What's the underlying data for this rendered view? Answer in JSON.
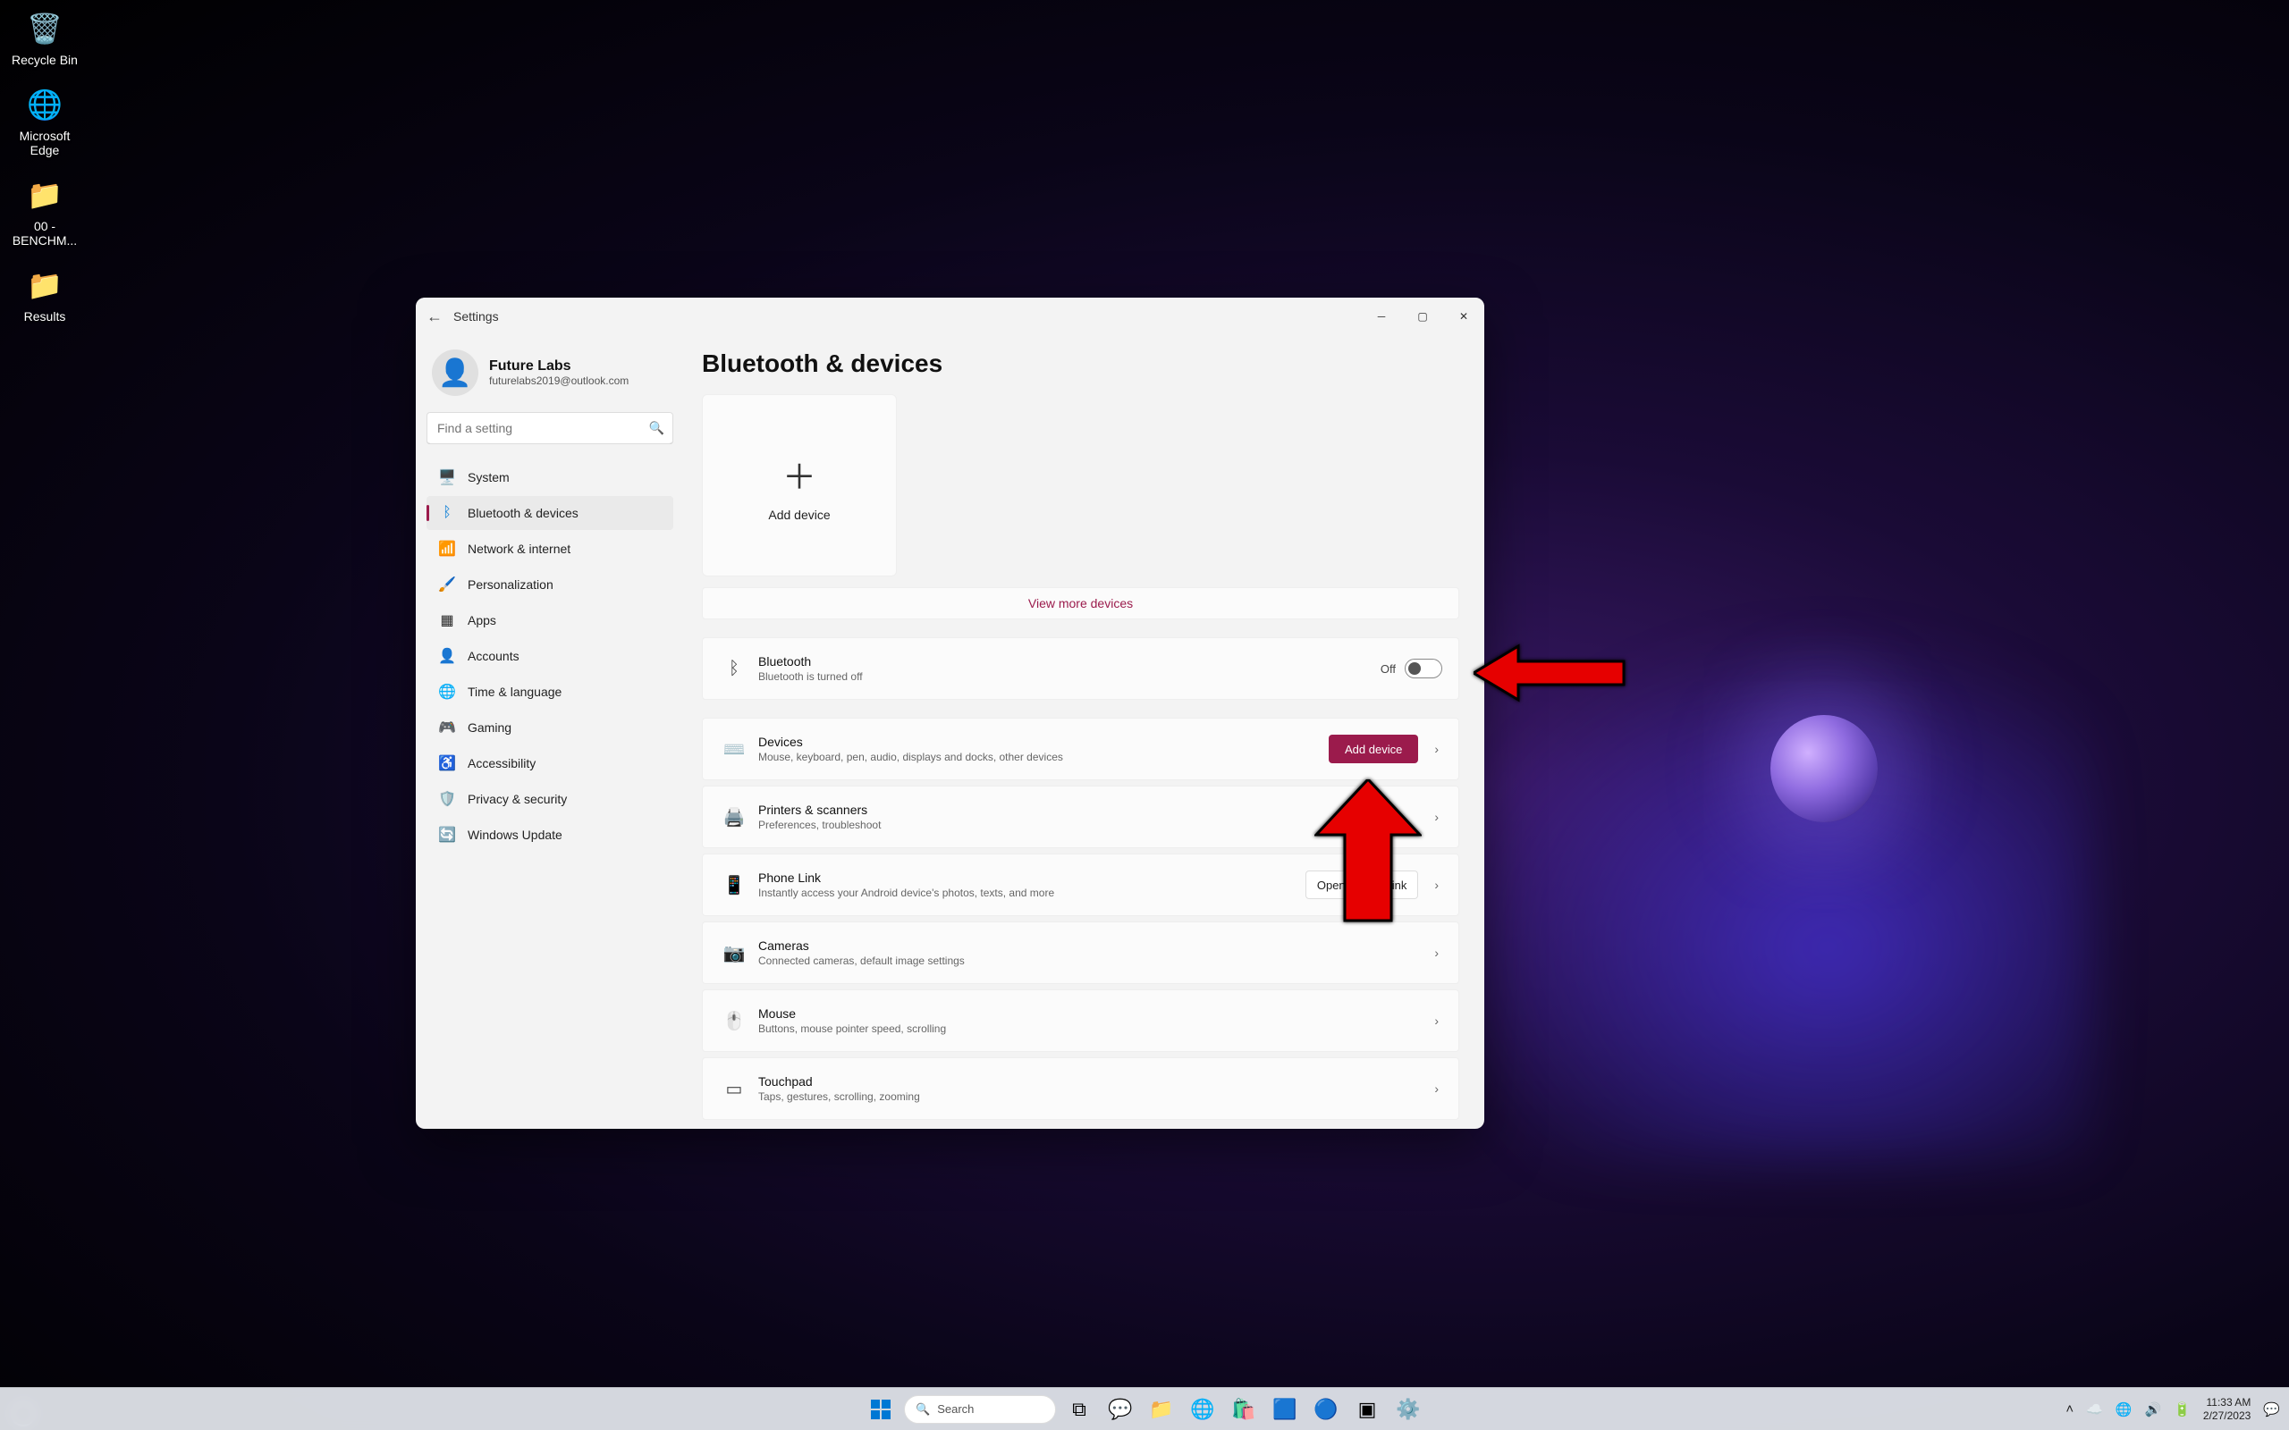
{
  "desktop": {
    "icons": [
      {
        "label": "Recycle Bin",
        "glyph": "🗑️"
      },
      {
        "label": "Microsoft\nEdge",
        "glyph": "🌐"
      },
      {
        "label": "00 -\nBENCHM...",
        "glyph": "📁"
      },
      {
        "label": "Results",
        "glyph": "📁"
      }
    ]
  },
  "settings": {
    "window_title": "Settings",
    "profile_name": "Future Labs",
    "profile_email": "futurelabs2019@outlook.com",
    "search_placeholder": "Find a setting",
    "nav": [
      {
        "label": "System",
        "glyph": "🖥️"
      },
      {
        "label": "Bluetooth & devices",
        "glyph": "ᛒ"
      },
      {
        "label": "Network & internet",
        "glyph": "📶"
      },
      {
        "label": "Personalization",
        "glyph": "🎨"
      },
      {
        "label": "Apps",
        "glyph": "▦"
      },
      {
        "label": "Accounts",
        "glyph": "👤"
      },
      {
        "label": "Time & language",
        "glyph": "🌐"
      },
      {
        "label": "Gaming",
        "glyph": "🎮"
      },
      {
        "label": "Accessibility",
        "glyph": "♿"
      },
      {
        "label": "Privacy & security",
        "glyph": "🛡️"
      },
      {
        "label": "Windows Update",
        "glyph": "🔄"
      }
    ],
    "page_title": "Bluetooth & devices",
    "add_device_card": "Add device",
    "view_more": "View more devices",
    "bluetooth": {
      "title": "Bluetooth",
      "subtitle": "Bluetooth is turned off",
      "state_label": "Off"
    },
    "rows": [
      {
        "key": "devices",
        "icon": "⌨️",
        "title": "Devices",
        "sub": "Mouse, keyboard, pen, audio, displays and docks, other devices",
        "action": "Add device"
      },
      {
        "key": "printers",
        "icon": "🖨️",
        "title": "Printers & scanners",
        "sub": "Preferences, troubleshoot"
      },
      {
        "key": "phone",
        "icon": "📱",
        "title": "Phone Link",
        "sub": "Instantly access your Android device's photos, texts, and more",
        "action": "Open Phone Link"
      },
      {
        "key": "cameras",
        "icon": "📷",
        "title": "Cameras",
        "sub": "Connected cameras, default image settings"
      },
      {
        "key": "mouse",
        "icon": "🖱️",
        "title": "Mouse",
        "sub": "Buttons, mouse pointer speed, scrolling"
      },
      {
        "key": "touchpad",
        "icon": "▭",
        "title": "Touchpad",
        "sub": "Taps, gestures, scrolling, zooming"
      }
    ]
  },
  "taskbar": {
    "search": "Search",
    "tray_time": "11:33 AM",
    "tray_date": "2/27/2023"
  }
}
